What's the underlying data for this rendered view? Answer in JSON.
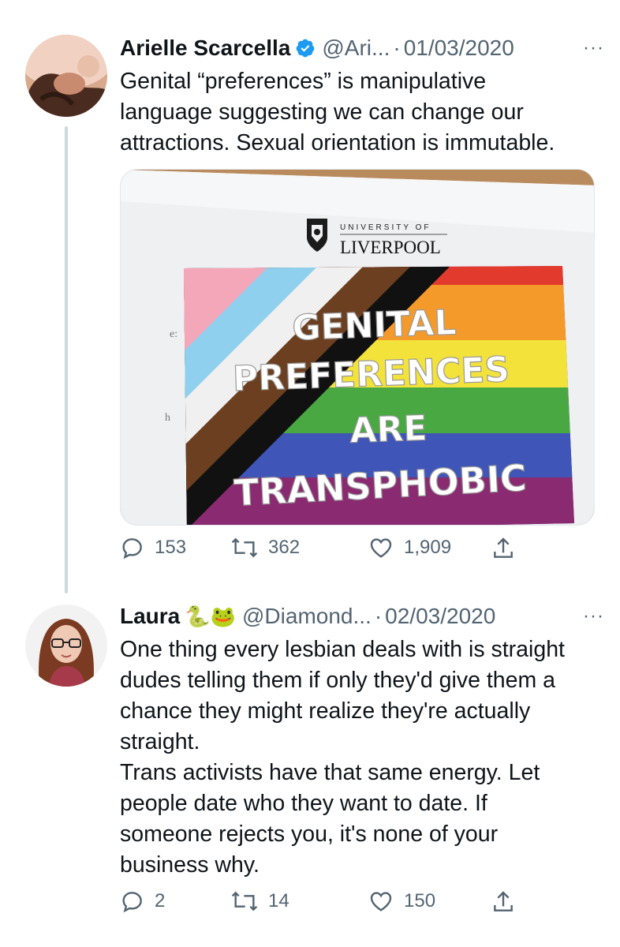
{
  "tweets": [
    {
      "author": {
        "name": "Arielle Scarcella",
        "verified": true,
        "handle": "@Ari...",
        "avatar": "avatar-woman-lying-down"
      },
      "date": "01/03/2020",
      "more_label": "···",
      "text_lines": [
        "Genital “preferences” is manipulative",
        "language suggesting we can change our",
        "attractions. Sexual orientation is immutable."
      ],
      "media": {
        "logo_top": "UNIVERSITY OF",
        "logo_name": "LIVERPOOL",
        "sign_lines": [
          "GENITAL",
          "PREFERENCES",
          "ARE",
          "TRANSPHOBIC"
        ],
        "stripe_colors": [
          "#f4a7b9",
          "#8fd0ee",
          "#f0f0f0",
          "#6b3f1f",
          "#111111",
          "#e23b2e",
          "#f49a2a",
          "#f2e23a",
          "#4aa843",
          "#3f55b8",
          "#7a2a86"
        ]
      },
      "stats": {
        "replies": "153",
        "retweets": "362",
        "likes": "1,909"
      }
    },
    {
      "author": {
        "name": "Laura",
        "emojis": "🐍🐸",
        "handle": "@Diamond...",
        "avatar": "avatar-woman-glasses"
      },
      "date": "02/03/2020",
      "more_label": "···",
      "text_lines": [
        "One thing every lesbian deals with is straight",
        "dudes telling them if only they'd give them a",
        "chance they might realize they're actually",
        "straight.",
        "Trans activists have that same energy. Let",
        "people date who they want to date. If",
        "someone rejects you, it's none of your",
        "business why."
      ],
      "stats": {
        "replies": "2",
        "retweets": "14",
        "likes": "150"
      }
    }
  ],
  "icons": [
    "reply-icon",
    "retweet-icon",
    "like-icon",
    "share-icon",
    "verified-badge-icon",
    "more-icon"
  ],
  "colors": {
    "text": "#0f1419",
    "secondary": "#536471",
    "verified": "#1d9bf0",
    "thread_line": "#cfd9de"
  }
}
